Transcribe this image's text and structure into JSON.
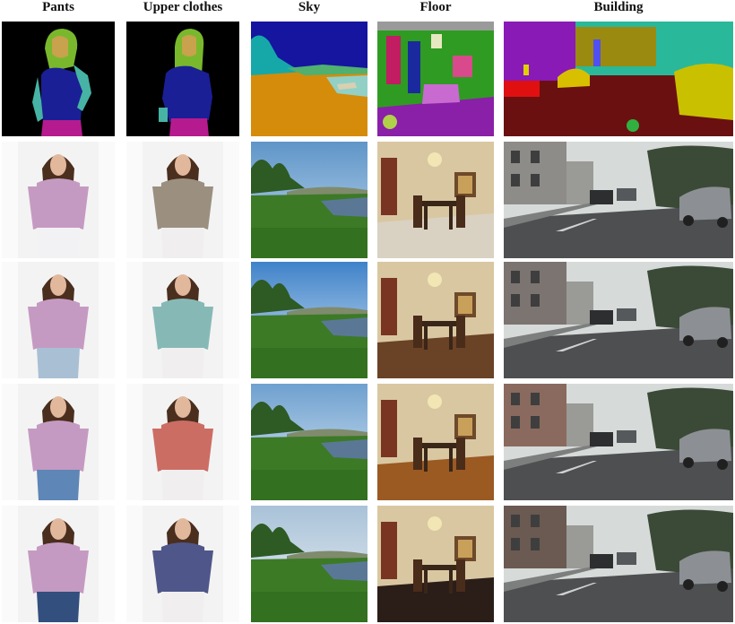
{
  "columns": [
    {
      "header": "Pants"
    },
    {
      "header": "Upper clothes"
    },
    {
      "header": "Sky"
    },
    {
      "header": "Floor"
    },
    {
      "header": "Building"
    }
  ],
  "rows": [
    {
      "kind": "segmentation-map"
    },
    {
      "kind": "result-1"
    },
    {
      "kind": "result-2"
    },
    {
      "kind": "result-3"
    },
    {
      "kind": "result-4"
    }
  ],
  "variants": {
    "pants": [
      "#f2f2f4",
      "#a9bfd4",
      "#5e86b6",
      "#324f7e"
    ],
    "upper": [
      "#9b8f80",
      "#86b9b6",
      "#cc6d64",
      "#4f568a"
    ],
    "sky_top": [
      "#5f95c8",
      "#3f82c9",
      "#6ea0cf",
      "#a9c2d8"
    ],
    "sky_bottom": [
      "#c4dbef",
      "#d9e9f6",
      "#e0ecf6",
      "#ecf2f6"
    ],
    "floor": [
      "#d9d2c2",
      "#6a4226",
      "#9a5a22",
      "#2b1d18"
    ],
    "building_wall": [
      "#8d8c88",
      "#7b7470",
      "#8a6a5e",
      "#6b5a52"
    ]
  }
}
